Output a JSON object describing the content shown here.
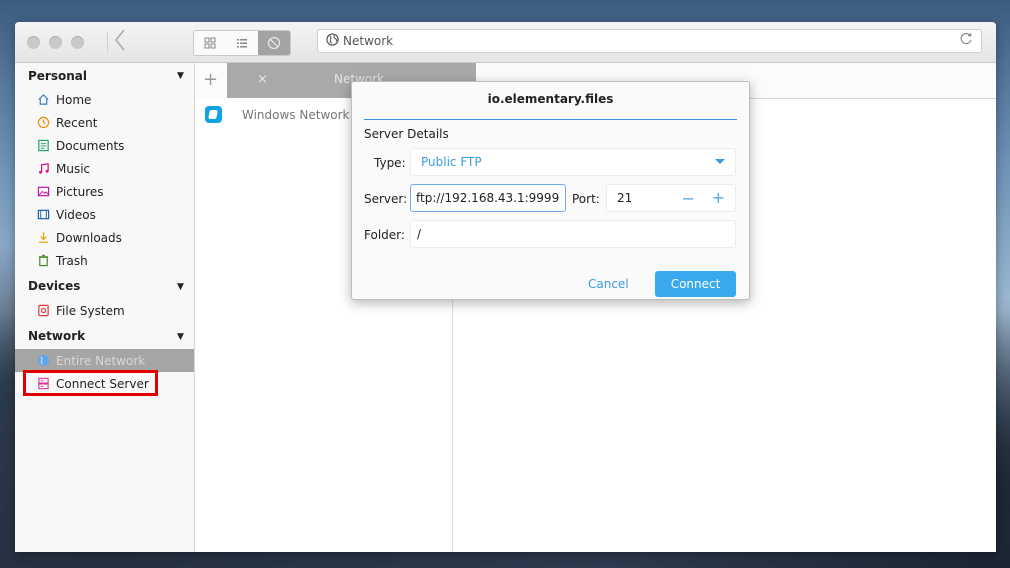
{
  "window": {
    "location": "Network",
    "tab_label": "Network",
    "tab_close": "×",
    "tab_add": "+"
  },
  "sidebar": {
    "personal": {
      "header": "Personal",
      "items": [
        {
          "label": "Home",
          "icon": "home-icon"
        },
        {
          "label": "Recent",
          "icon": "recent-icon"
        },
        {
          "label": "Documents",
          "icon": "documents-icon"
        },
        {
          "label": "Music",
          "icon": "music-icon"
        },
        {
          "label": "Pictures",
          "icon": "pictures-icon"
        },
        {
          "label": "Videos",
          "icon": "videos-icon"
        },
        {
          "label": "Downloads",
          "icon": "downloads-icon"
        },
        {
          "label": "Trash",
          "icon": "trash-icon"
        }
      ]
    },
    "devices": {
      "header": "Devices",
      "items": [
        {
          "label": "File System",
          "icon": "drive-icon"
        }
      ]
    },
    "network": {
      "header": "Network",
      "items": [
        {
          "label": "Entire Network",
          "icon": "globe-icon"
        },
        {
          "label": "Connect Server",
          "icon": "server-icon"
        }
      ]
    }
  },
  "column": {
    "items": [
      {
        "label": "Windows Network",
        "icon": "windows-network-icon"
      }
    ]
  },
  "dialog": {
    "title": "io.elementary.files",
    "section": "Server Details",
    "type_label": "Type:",
    "type_value": "Public FTP",
    "server_label": "Server:",
    "server_value": "ftp://192.168.43.1:9999",
    "port_label": "Port:",
    "port_value": "21",
    "port_minus": "−",
    "port_plus": "+",
    "folder_label": "Folder:",
    "folder_value": "/",
    "cancel_label": "Cancel",
    "connect_label": "Connect"
  },
  "colors": {
    "accent": "#3aa8ee",
    "highlight": "#e00000"
  }
}
